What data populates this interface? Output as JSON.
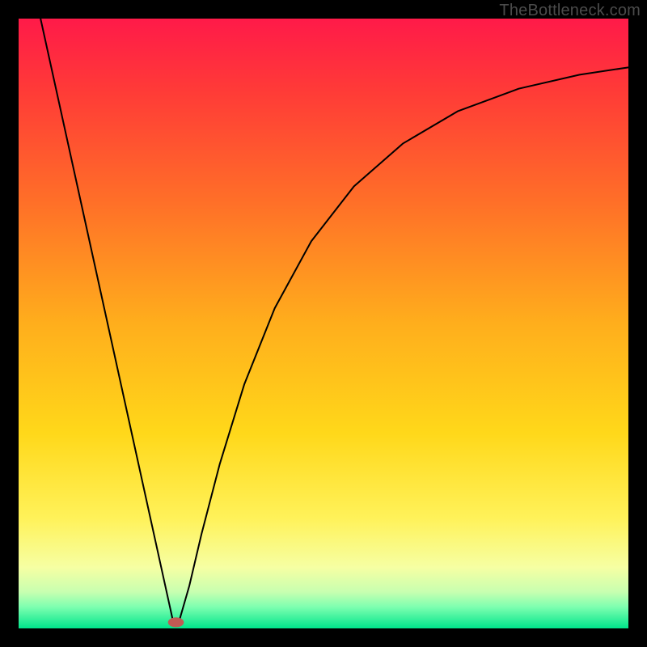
{
  "watermark": "TheBottleneck.com",
  "chart_data": {
    "type": "line",
    "title": "",
    "xlabel": "",
    "ylabel": "",
    "xlim": [
      0,
      100
    ],
    "ylim": [
      0,
      100
    ],
    "grid": false,
    "legend": false,
    "gradient_stops": [
      {
        "offset": 0.0,
        "color": "#ff1a49"
      },
      {
        "offset": 0.12,
        "color": "#ff3b37"
      },
      {
        "offset": 0.3,
        "color": "#ff6f28"
      },
      {
        "offset": 0.5,
        "color": "#ffae1c"
      },
      {
        "offset": 0.68,
        "color": "#ffd81a"
      },
      {
        "offset": 0.82,
        "color": "#fff25a"
      },
      {
        "offset": 0.9,
        "color": "#f6ffa3"
      },
      {
        "offset": 0.94,
        "color": "#c8ffb0"
      },
      {
        "offset": 0.965,
        "color": "#7dffb0"
      },
      {
        "offset": 1.0,
        "color": "#00e58b"
      }
    ],
    "marker": {
      "cx": 25.8,
      "cy": 99.0,
      "rx": 1.3,
      "ry": 0.8,
      "fill": "#c15a54"
    },
    "series": [
      {
        "name": "bottleneck-curve",
        "stroke": "#000000",
        "stroke_width": 2,
        "points": [
          {
            "x": 3.6,
            "y": 100.0
          },
          {
            "x": 25.5,
            "y": 0.4
          },
          {
            "x": 26.1,
            "y": 0.4
          },
          {
            "x": 28.0,
            "y": 7.0
          },
          {
            "x": 30.0,
            "y": 15.5
          },
          {
            "x": 33.0,
            "y": 27.0
          },
          {
            "x": 37.0,
            "y": 40.0
          },
          {
            "x": 42.0,
            "y": 52.5
          },
          {
            "x": 48.0,
            "y": 63.5
          },
          {
            "x": 55.0,
            "y": 72.5
          },
          {
            "x": 63.0,
            "y": 79.5
          },
          {
            "x": 72.0,
            "y": 84.8
          },
          {
            "x": 82.0,
            "y": 88.5
          },
          {
            "x": 92.0,
            "y": 90.8
          },
          {
            "x": 100.0,
            "y": 92.0
          }
        ]
      }
    ]
  }
}
